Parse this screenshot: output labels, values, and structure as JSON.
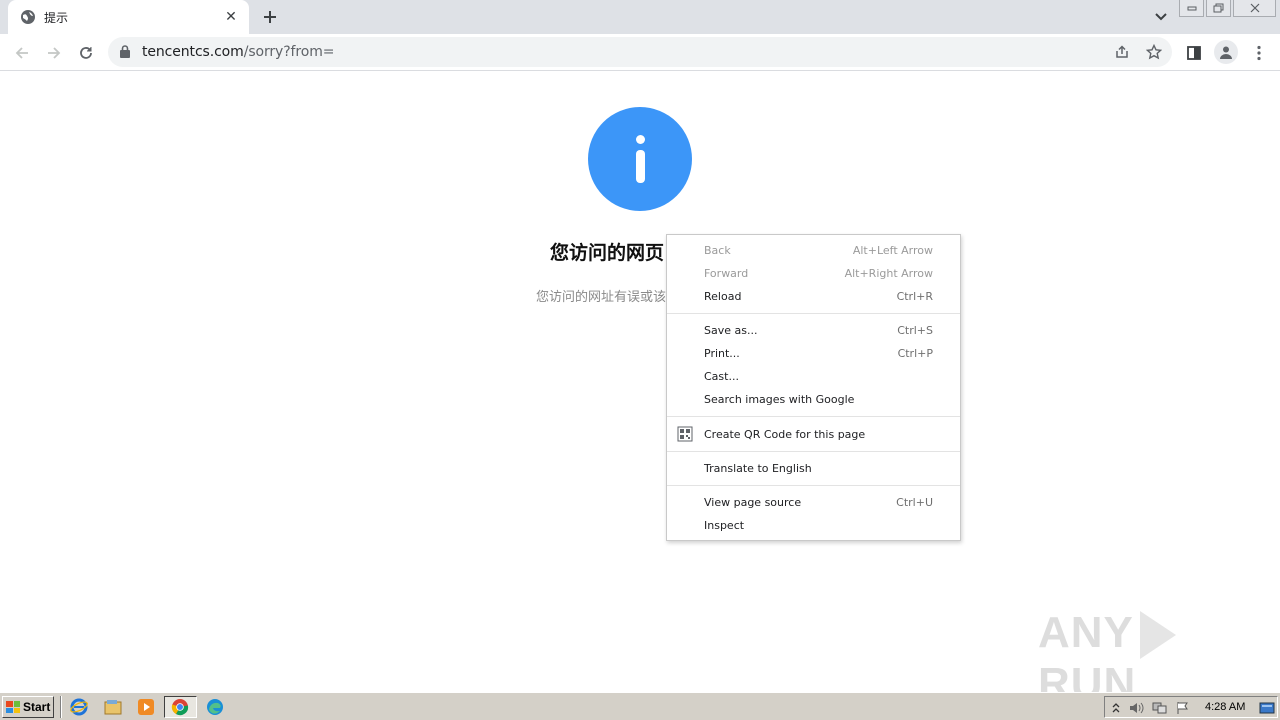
{
  "browser": {
    "tab": {
      "title": "提示",
      "favicon": "globe-icon",
      "close_icon": "close-icon"
    },
    "new_tab_icon": "plus-icon",
    "tab_search_icon": "chevron-down-icon",
    "window_controls": [
      "minimize-icon",
      "restore-icon",
      "close-icon"
    ],
    "url": {
      "host": "tencentcs.com",
      "path": "/sorry?from="
    },
    "toolbar_icons": [
      "back-arrow-icon",
      "forward-arrow-icon",
      "reload-icon",
      "lock-icon",
      "share-icon",
      "star-icon",
      "side-panel-icon",
      "profile-icon",
      "kebab-menu-icon"
    ]
  },
  "page": {
    "icon": "info-icon",
    "icon_color": "#3c96f8",
    "heading": "您访问的网页",
    "description": "您访问的网址有误或该"
  },
  "context_menu": {
    "groups": [
      [
        {
          "label": "Back",
          "shortcut": "Alt+Left Arrow",
          "disabled": true
        },
        {
          "label": "Forward",
          "shortcut": "Alt+Right Arrow",
          "disabled": true
        },
        {
          "label": "Reload",
          "shortcut": "Ctrl+R",
          "disabled": false
        }
      ],
      [
        {
          "label": "Save as...",
          "shortcut": "Ctrl+S",
          "disabled": false
        },
        {
          "label": "Print...",
          "shortcut": "Ctrl+P",
          "disabled": false
        },
        {
          "label": "Cast...",
          "shortcut": "",
          "disabled": false
        },
        {
          "label": "Search images with Google",
          "shortcut": "",
          "disabled": false
        }
      ],
      [
        {
          "label": "Create QR Code for this page",
          "shortcut": "",
          "icon": "qr-code-icon",
          "disabled": false
        }
      ],
      [
        {
          "label": "Translate to English",
          "shortcut": "",
          "disabled": false
        }
      ],
      [
        {
          "label": "View page source",
          "shortcut": "Ctrl+U",
          "disabled": false
        },
        {
          "label": "Inspect",
          "shortcut": "",
          "disabled": false
        }
      ]
    ]
  },
  "watermark": {
    "left": "ANY",
    "right": "RUN"
  },
  "taskbar": {
    "start_label": "Start",
    "quick_launch": [
      "internet-explorer-icon",
      "file-explorer-icon",
      "media-player-icon",
      "chrome-icon",
      "edge-icon"
    ],
    "tray_icons": [
      "show-hidden-icon",
      "volume-icon",
      "network-icon",
      "action-center-flag-icon"
    ],
    "clock": "4:28 AM",
    "show_desktop_icon": "show-desktop-icon"
  }
}
